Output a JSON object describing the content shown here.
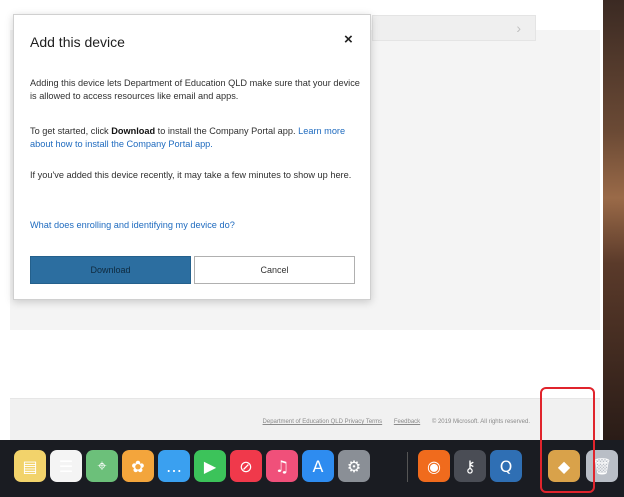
{
  "dialog": {
    "title": "Add this device",
    "close_glyph": "×",
    "para1": "Adding this device lets Department of Education QLD make sure that your device is allowed to access resources like email and apps.",
    "para2_prefix": "To get started, click ",
    "para2_bold": "Download",
    "para2_middle": " to install the Company Portal app. ",
    "para2_link": "Learn more about how to install the Company Portal app.",
    "para3": "If you've added this device recently, it may take a few minutes to show up here.",
    "help_link": "What does enrolling and identifying my device do?",
    "download_label": "Download",
    "cancel_label": "Cancel"
  },
  "footer": {
    "privacy": "Department of Education QLD Privacy Terms",
    "feedback": "Feedback",
    "copyright": "© 2019 Microsoft. All rights reserved."
  },
  "background": {
    "chevron": "›"
  },
  "dock": {
    "icons": [
      {
        "name": "notes-icon",
        "glyph": "▤",
        "color": "#f2d36b"
      },
      {
        "name": "reminders-icon",
        "glyph": "☰",
        "color": "#f4f4f4"
      },
      {
        "name": "maps-icon",
        "glyph": "⌖",
        "color": "#6cc07a"
      },
      {
        "name": "photos-icon",
        "glyph": "✿",
        "color": "#f3a53c"
      },
      {
        "name": "messages-icon",
        "glyph": "…",
        "color": "#3aa0f0"
      },
      {
        "name": "facetime-icon",
        "glyph": "▶",
        "color": "#3cc35a"
      },
      {
        "name": "news-icon",
        "glyph": "⊘",
        "color": "#f0394b"
      },
      {
        "name": "music-icon",
        "glyph": "♫",
        "color": "#f0507a"
      },
      {
        "name": "app-store-icon",
        "glyph": "A",
        "color": "#2e8cf0"
      },
      {
        "name": "system-preferences-icon",
        "glyph": "⚙",
        "color": "#8a8f96"
      },
      {
        "name": "firefox-icon",
        "glyph": "◉",
        "color": "#f06b1d"
      },
      {
        "name": "keychain-icon",
        "glyph": "⚷",
        "color": "#4a4d55"
      },
      {
        "name": "quicktime-icon",
        "glyph": "Q",
        "color": "#2f6fb4"
      },
      {
        "name": "package-installer-icon",
        "glyph": "◆",
        "color": "#d9a24a"
      },
      {
        "name": "trash-icon",
        "glyph": "🗑",
        "color": "#b9bec6"
      }
    ]
  }
}
